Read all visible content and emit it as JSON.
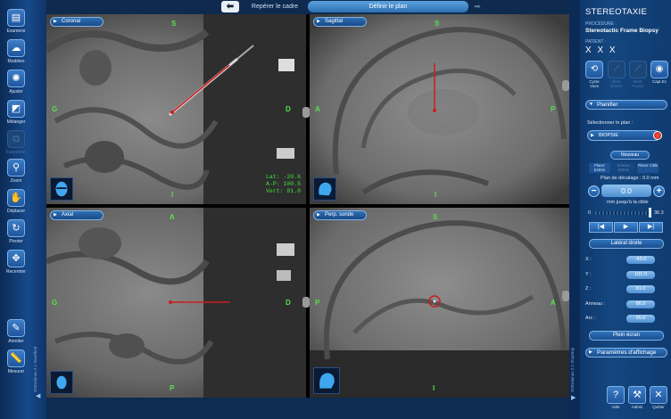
{
  "workflow": {
    "back_icon": "arrow-left-icon",
    "steps": [
      "Repérer le cadre",
      "Définir le plan"
    ],
    "active_step": 1,
    "forward_icon": "arrow-right-icon"
  },
  "left_tools": [
    {
      "label": "Examens",
      "icon": "film-icon",
      "enabled": true
    },
    {
      "label": "Modèles",
      "icon": "brain-icon",
      "enabled": true
    },
    {
      "label": "Ajuster",
      "icon": "sun-icon",
      "enabled": true
    },
    {
      "label": "Mélanger",
      "icon": "blend-icon",
      "enabled": true
    },
    {
      "label": "Fusionner",
      "icon": "fusion-icon",
      "enabled": false
    },
    {
      "label": "Zoom",
      "icon": "magnifier-icon",
      "enabled": true
    },
    {
      "label": "Déplacer",
      "icon": "hand-icon",
      "enabled": true
    },
    {
      "label": "Pivoter",
      "icon": "rotate-icon",
      "enabled": true
    },
    {
      "label": "Recentrer",
      "icon": "recenter-icon",
      "enabled": true
    },
    {
      "label": "Annoter",
      "icon": "pen-icon",
      "enabled": true
    },
    {
      "label": "Mesurer",
      "icon": "ruler-icon",
      "enabled": true
    }
  ],
  "left_version": "3DBrainnav 2.1 Stealthed",
  "panes": [
    {
      "id": "coronal",
      "label": "Coronal",
      "orient": {
        "top": "S",
        "bottom": "I",
        "left": "G",
        "right": "D"
      }
    },
    {
      "id": "sagittal",
      "label": "Sagittal",
      "orient": {
        "top": "S",
        "bottom": "I",
        "left": "A",
        "right": "P"
      }
    },
    {
      "id": "axial",
      "label": "Axial",
      "orient": {
        "top": "A",
        "bottom": "P",
        "left": "G",
        "right": "D"
      }
    },
    {
      "id": "probe",
      "label": "Perp. sonde",
      "orient": {
        "top": "S",
        "bottom": "I",
        "left": "P",
        "right": "A"
      }
    }
  ],
  "coords": {
    "lat": "Lat:  -20.6",
    "ap": "A-P: 100.5",
    "vert": "Vert: 81.0"
  },
  "right_panel": {
    "title": "STEREOTAXIE",
    "procedure_label": "PROCÉDURE :",
    "procedure_value": "Stereotactic Frame Biopsy",
    "patient_label": "PATIENT :",
    "patient_value": "X X X",
    "modes": [
      {
        "label": "Cycle Vues",
        "icon": "cycle-views-icon",
        "enabled": true
      },
      {
        "label": "Ident. Entrée",
        "icon": "entry-icon",
        "enabled": false
      },
      {
        "label": "Ident. Fusion",
        "icon": "fusion-id-icon",
        "enabled": false
      },
      {
        "label": "Capt.Ec",
        "icon": "camera-icon",
        "enabled": true
      }
    ],
    "plan_section": "Planifier",
    "select_plan_label": "Sélectionner le plan :",
    "plan_value": "BIOPSIE",
    "new_button": "Nouveau",
    "placement": [
      {
        "label": "Placer Entrée",
        "enabled": true
      },
      {
        "label": "Enlever Entrée",
        "enabled": false
      },
      {
        "label": "Placer Cible",
        "enabled": true
      }
    ],
    "offset_label": "Plan de décalage : 0.0 mm",
    "offset_value": "0.0",
    "minus": "−",
    "plus": "+",
    "to_target_label": "mm jusqu'à la cible",
    "slider_min": "0",
    "slider_max": "36.3",
    "slider_fraction": 1.0,
    "nav": [
      "|◀",
      "▶",
      "▶|"
    ],
    "lateral_button": "Latéral droite",
    "fields": [
      {
        "label": "X :",
        "value": "-43.0"
      },
      {
        "label": "Y :",
        "value": "101.0"
      },
      {
        "label": "Z :",
        "value": "81.0"
      },
      {
        "label": "Anneau :",
        "value": "86.0"
      },
      {
        "label": "Arc :",
        "value": "95.0"
      }
    ],
    "fullscreen_button": "Plein écran",
    "display_section": "Paramètres d'affichage",
    "corner": [
      {
        "label": "Aide",
        "icon": "help-icon",
        "glyph": "?"
      },
      {
        "label": "Admin",
        "icon": "wrench-icon",
        "glyph": "🔧"
      },
      {
        "label": "Quitter",
        "icon": "close-icon",
        "glyph": "✕"
      }
    ]
  },
  "right_version": "3DBrainnav 2.1 StopMap",
  "colors": {
    "accent": "#2e73bd",
    "trajectory": "#c81e1e",
    "overlay_text": "#3fe23a",
    "orient_text": "#56e04b"
  }
}
